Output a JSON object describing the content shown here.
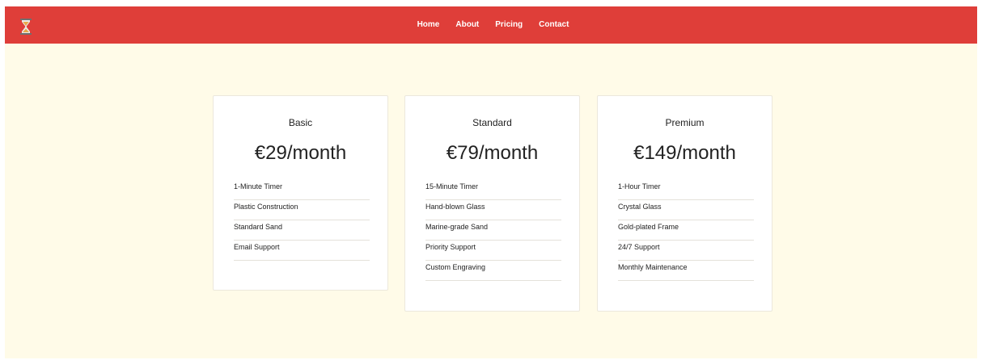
{
  "nav": {
    "logo_icon": "hourglass-icon",
    "links": [
      "Home",
      "About",
      "Pricing",
      "Contact"
    ]
  },
  "colors": {
    "navbar": "#df3e39",
    "page_background": "#fffbe8",
    "card_background": "#ffffff",
    "logo_sand": "#e8a84a"
  },
  "plans": [
    {
      "name": "Basic",
      "price": "€29/month",
      "features": [
        "1-Minute Timer",
        "Plastic Construction",
        "Standard Sand",
        "Email Support"
      ]
    },
    {
      "name": "Standard",
      "price": "€79/month",
      "features": [
        "15-Minute Timer",
        "Hand-blown Glass",
        "Marine-grade Sand",
        "Priority Support",
        "Custom Engraving"
      ]
    },
    {
      "name": "Premium",
      "price": "€149/month",
      "features": [
        "1-Hour Timer",
        "Crystal Glass",
        "Gold-plated Frame",
        "24/7 Support",
        "Monthly Maintenance"
      ]
    }
  ]
}
